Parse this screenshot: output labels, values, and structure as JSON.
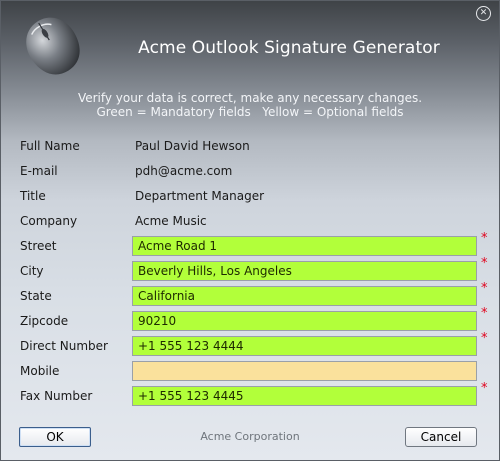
{
  "window": {
    "title": "Acme Outlook Signature Generator",
    "instructions": {
      "line1": "Verify your data is correct, make any necessary changes.",
      "line2": "Green = Mandatory fields   Yellow = Optional fields"
    },
    "close_icon": "close-icon",
    "logo_icon": "computer-mouse-icon"
  },
  "info": {
    "full_name": {
      "label": "Full Name",
      "value": "Paul David Hewson"
    },
    "email": {
      "label": "E-mail",
      "value": "pdh@acme.com"
    },
    "title": {
      "label": "Title",
      "value": "Department Manager"
    },
    "company": {
      "label": "Company",
      "value": "Acme Music"
    }
  },
  "fields": {
    "street": {
      "label": "Street",
      "value": "Acme Road 1",
      "required_mark": "*",
      "mandatory": true
    },
    "city": {
      "label": "City",
      "value": "Beverly Hills, Los Angeles",
      "required_mark": "*",
      "mandatory": true
    },
    "state": {
      "label": "State",
      "value": "California",
      "required_mark": "*",
      "mandatory": true
    },
    "zipcode": {
      "label": "Zipcode",
      "value": "90210",
      "required_mark": "*",
      "mandatory": true
    },
    "direct_number": {
      "label": "Direct Number",
      "value": "+1 555 123 4444",
      "required_mark": "*",
      "mandatory": true
    },
    "mobile": {
      "label": "Mobile",
      "value": "",
      "mandatory": false
    },
    "fax_number": {
      "label": "Fax Number",
      "value": "+1 555 123 4445",
      "required_mark": "*",
      "mandatory": true
    }
  },
  "footer": {
    "ok_label": "OK",
    "company_text": "Acme Corporation",
    "cancel_label": "Cancel"
  },
  "colors": {
    "mandatory": "#b2ff3a",
    "optional": "#fae19c",
    "required_mark": "#e0001a"
  }
}
